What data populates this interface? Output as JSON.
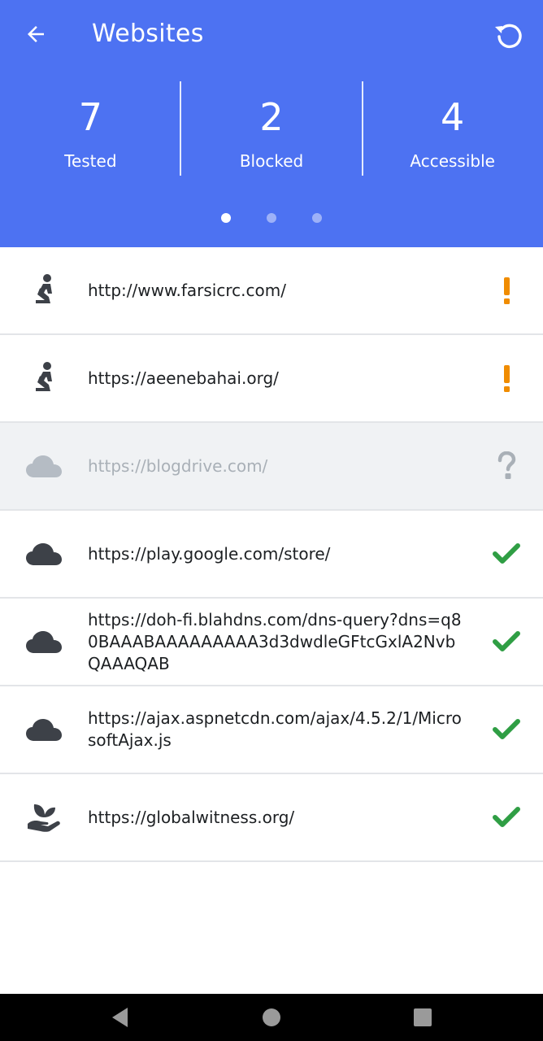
{
  "app": {
    "title": "Websites",
    "header_color": "#4d72f2",
    "back_icon": "arrow-left-icon",
    "refresh_icon": "refresh-icon"
  },
  "stats": [
    {
      "value": "7",
      "label": "Tested"
    },
    {
      "value": "2",
      "label": "Blocked"
    },
    {
      "value": "4",
      "label": "Accessible"
    }
  ],
  "pager": {
    "total_pages": 3,
    "current_page": 1
  },
  "sites": [
    {
      "url": "http://www.farsicrc.com/",
      "category_icon": "praying-person-icon",
      "status": "blocked",
      "status_icon": "exclamation-icon"
    },
    {
      "url": "https://aeenebahai.org/",
      "category_icon": "praying-person-icon",
      "status": "blocked",
      "status_icon": "exclamation-icon"
    },
    {
      "url": "https://blogdrive.com/",
      "category_icon": "cloud-icon",
      "status": "unknown",
      "status_icon": "question-icon"
    },
    {
      "url": "https://play.google.com/store/",
      "category_icon": "cloud-icon",
      "status": "accessible",
      "status_icon": "checkmark-icon"
    },
    {
      "url": "https://doh-fi.blahdns.com/dns-query?dns=q80BAAABAAAAAAAAA3d3dwdleGFtcGxlA2NvbQAAAQAB",
      "category_icon": "cloud-icon",
      "status": "accessible",
      "status_icon": "checkmark-icon"
    },
    {
      "url": "https://ajax.aspnetcdn.com/ajax/4.5.2/1/MicrosoftAjax.js",
      "category_icon": "cloud-icon",
      "status": "accessible",
      "status_icon": "checkmark-icon"
    },
    {
      "url": "https://globalwitness.org/",
      "category_icon": "hand-leaf-icon",
      "status": "accessible",
      "status_icon": "checkmark-icon"
    }
  ],
  "status_colors": {
    "blocked": "#f08c00",
    "unknown": "#a9b0b7",
    "accessible": "#2f9e44"
  },
  "navbar": {
    "back_icon": "nav-back-triangle-icon",
    "home_icon": "nav-home-circle-icon",
    "recents_icon": "nav-recents-square-icon"
  }
}
